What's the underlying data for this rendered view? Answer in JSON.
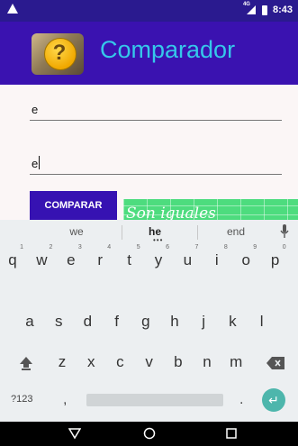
{
  "status": {
    "network": "4G",
    "time": "8:43"
  },
  "app": {
    "title": "Comparador",
    "icon": "question-book-icon"
  },
  "inputs": {
    "first": "e",
    "second": "e"
  },
  "button": {
    "label": "COMPARAR"
  },
  "result": {
    "text": "Son iguales",
    "bg": "#4ddc7e"
  },
  "keyboard": {
    "suggestions": [
      "we",
      "he",
      "end"
    ],
    "row1": [
      {
        "k": "q",
        "h": "1"
      },
      {
        "k": "w",
        "h": "2"
      },
      {
        "k": "e",
        "h": "3"
      },
      {
        "k": "r",
        "h": "4"
      },
      {
        "k": "t",
        "h": "5"
      },
      {
        "k": "y",
        "h": "6"
      },
      {
        "k": "u",
        "h": "7"
      },
      {
        "k": "i",
        "h": "8"
      },
      {
        "k": "o",
        "h": "9"
      },
      {
        "k": "p",
        "h": "0"
      }
    ],
    "row2": [
      "a",
      "s",
      "d",
      "f",
      "g",
      "h",
      "j",
      "k",
      "l"
    ],
    "row3": [
      "z",
      "x",
      "c",
      "v",
      "b",
      "n",
      "m"
    ],
    "symbols_label": "?123",
    "comma": ",",
    "period": "."
  },
  "colors": {
    "status_bar": "#2a1a8f",
    "app_bar": "#3a12b0",
    "title": "#35c8ea",
    "button": "#3612b2",
    "enter": "#4db6ac"
  }
}
